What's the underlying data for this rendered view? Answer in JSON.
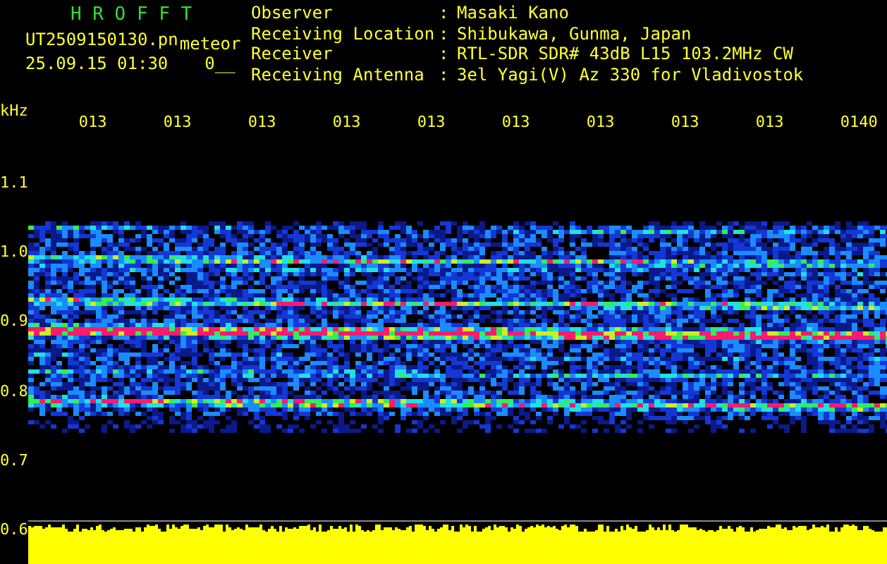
{
  "header": {
    "title": "H R O F F T",
    "file": "UT2509150130.pn",
    "tag": "meteor",
    "datetime": "25.09.15 01:30",
    "counter": "0__"
  },
  "info": [
    {
      "label": "Observer",
      "separator": ":",
      "value": "Masaki Kano"
    },
    {
      "label": "Receiving Location",
      "separator": ":",
      "value": "Shibukawa, Gunma, Japan"
    },
    {
      "label": "Receiver",
      "separator": ":",
      "value": "RTL-SDR SDR# 43dB L15 103.2MHz CW"
    },
    {
      "label": "Receiving Antenna",
      "separator": ":",
      "value": "3el Yagi(V) Az 330 for Vladivostok"
    }
  ],
  "axis": {
    "unit": "kHz",
    "time_labels": [
      "013",
      "013",
      "013",
      "013",
      "013",
      "013",
      "013",
      "013",
      "013",
      "0140"
    ],
    "freq_labels": [
      "1.1",
      "1.0",
      "0.9",
      "0.8",
      "0.7",
      "0.6"
    ]
  }
}
